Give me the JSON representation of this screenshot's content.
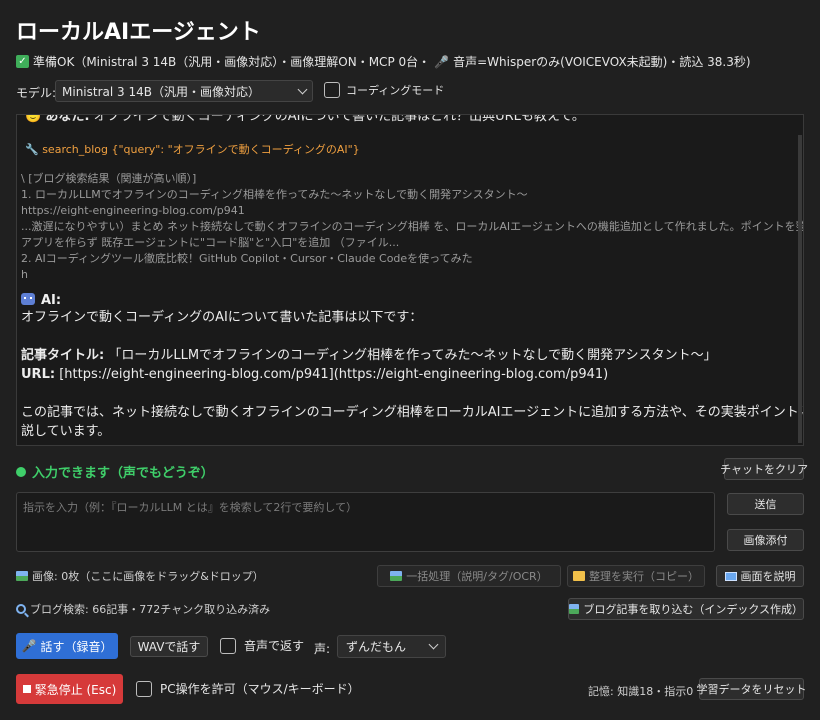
{
  "app": {
    "title": "ローカルAIエージェント",
    "status_text": "準備OK（Ministral 3 14B（汎用・画像対応）・画像理解ON・MCP 0台・",
    "status_voice": "音声=Whisperのみ(VOICEVOX未起動)・読込 38.3秒)"
  },
  "model": {
    "label": "モデル:",
    "selected": "Ministral 3 14B（汎用・画像対応）",
    "coding_mode_label": "コーディングモード"
  },
  "chat": {
    "user_prefix": "あなた:",
    "user_message": "オフラインで動くコーディングのAIについて書いた記事はどれ？出典URLも教えて。",
    "tool_call": "search_blog {\"query\": \"オフラインで動くコーディングのAI\"}",
    "search_result_lines": [
      "\\ [ブログ検索結果（関連が高い順）]",
      "1. ローカルLLMでオフラインのコーディング相棒を作ってみた〜ネットなしで動く開発アシスタント〜",
      "https://eight-engineering-blog.com/p941",
      "...激遅になりやすい）まとめ ネット接続なしで動くオフラインのコーディング相棒 を、ローカルAIエージェントへの機能追加として作れました。ポイントを整理します。独立",
      "アプリを作らず 既存エージェントに\"コード脳\"と\"入口\"を追加 （ファイル...",
      "2. AIコーディングツール徹底比較！GitHub Copilot・Cursor・Claude Codeを使ってみた",
      "h"
    ],
    "ai_label": "AI:",
    "ai_intro": "オフラインで動くコーディングのAIについて書いた記事は以下です：",
    "ai_title_label": "記事タイトル:",
    "ai_title_value": "「ローカルLLMでオフラインのコーディング相棒を作ってみた〜ネットなしで動く開発アシスタント〜」",
    "ai_url_label": "URL:",
    "ai_url_value": "[https://eight-engineering-blog.com/p941](https://eight-engineering-blog.com/p941)",
    "ai_body_1": "この記事では、ネット接続なしで動くオフラインのコーディング相棒をローカルAIエージェントに追加する方法や、その実装ポイントについて詳しく解",
    "ai_body_2": "説しています。"
  },
  "input": {
    "ready_text": "入力できます（声でもどうぞ）",
    "clear_label": "チャットをクリア",
    "placeholder": "指示を入力（例：『ローカルLLM とは』を検索して2行で要約して）",
    "send_label": "送信",
    "attach_label": "画像添付"
  },
  "images": {
    "status": "画像: 0枚（ここに画像をドラッグ&ドロップ）",
    "batch_label": "一括処理（説明/タグ/OCR）",
    "organize_label": "整理を実行（コピー）",
    "explain_screen_label": "画面を説明"
  },
  "blog": {
    "status": "ブログ検索: 66記事・772チャンク取り込み済み",
    "import_label": "ブログ記事を取り込む（インデックス作成）"
  },
  "voice": {
    "talk_label": "話す（録音）",
    "wav_label": "WAVで話す",
    "reply_voice_label": "音声で返す",
    "voice_label": "声:",
    "voice_selected": "ずんだもん"
  },
  "bottom": {
    "stop_label": "緊急停止 (Esc)",
    "pc_control_label": "PC操作を許可（マウス/キーボード）",
    "memory_text": "記憶: 知識18・指示0",
    "reset_label": "学習データをリセット"
  }
}
